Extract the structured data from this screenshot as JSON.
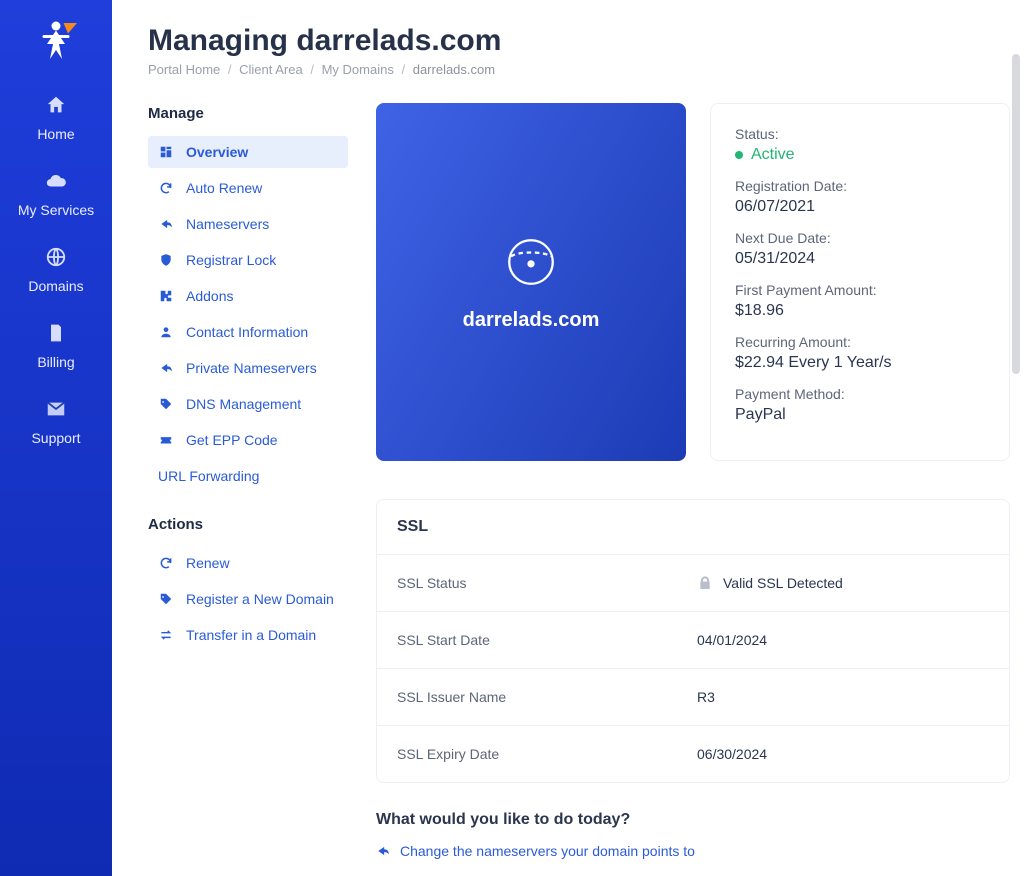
{
  "page": {
    "title": "Managing darrelads.com"
  },
  "breadcrumb": {
    "items": [
      "Portal Home",
      "Client Area",
      "My Domains"
    ],
    "current": "darrelads.com"
  },
  "sidebar": {
    "items": [
      {
        "id": "home",
        "label": "Home"
      },
      {
        "id": "services",
        "label": "My Services"
      },
      {
        "id": "domains",
        "label": "Domains"
      },
      {
        "id": "billing",
        "label": "Billing"
      },
      {
        "id": "support",
        "label": "Support"
      }
    ]
  },
  "manage": {
    "heading": "Manage",
    "items": [
      {
        "id": "overview",
        "label": "Overview",
        "active": true
      },
      {
        "id": "auto-renew",
        "label": "Auto Renew"
      },
      {
        "id": "nameservers",
        "label": "Nameservers"
      },
      {
        "id": "registrar-lock",
        "label": "Registrar Lock"
      },
      {
        "id": "addons",
        "label": "Addons"
      },
      {
        "id": "contact-info",
        "label": "Contact Information"
      },
      {
        "id": "private-ns",
        "label": "Private Nameservers"
      },
      {
        "id": "dns",
        "label": "DNS Management"
      },
      {
        "id": "epp",
        "label": "Get EPP Code"
      },
      {
        "id": "url-forwarding",
        "label": "URL Forwarding",
        "noicon": true
      }
    ]
  },
  "actions": {
    "heading": "Actions",
    "items": [
      {
        "id": "renew",
        "label": "Renew"
      },
      {
        "id": "register",
        "label": "Register a New Domain"
      },
      {
        "id": "transfer",
        "label": "Transfer in a Domain"
      }
    ]
  },
  "domain": {
    "name": "darrelads.com"
  },
  "status": {
    "status_label": "Status:",
    "status_value": "Active",
    "reg_date_label": "Registration Date:",
    "reg_date_value": "06/07/2021",
    "due_date_label": "Next Due Date:",
    "due_date_value": "05/31/2024",
    "first_pay_label": "First Payment Amount:",
    "first_pay_value": "$18.96",
    "recurring_label": "Recurring Amount:",
    "recurring_value": "$22.94 Every 1 Year/s",
    "paymethod_label": "Payment Method:",
    "paymethod_value": "PayPal"
  },
  "ssl": {
    "heading": "SSL",
    "rows": [
      {
        "k": "SSL Status",
        "v": "Valid SSL Detected",
        "lock": true
      },
      {
        "k": "SSL Start Date",
        "v": "04/01/2024"
      },
      {
        "k": "SSL Issuer Name",
        "v": "R3"
      },
      {
        "k": "SSL Expiry Date",
        "v": "06/30/2024"
      }
    ]
  },
  "today": {
    "heading": "What would you like to do today?",
    "link1": "Change the nameservers your domain points to"
  }
}
